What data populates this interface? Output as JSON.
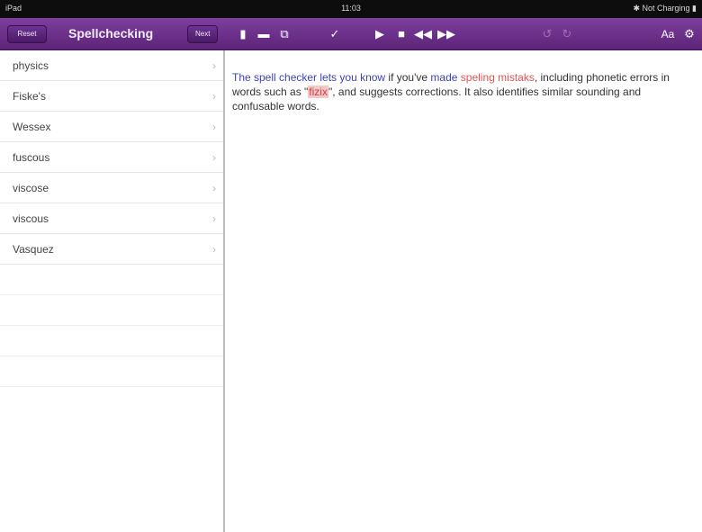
{
  "statusbar": {
    "device": "iPad",
    "time": "11:03",
    "battery": "Not Charging"
  },
  "toolbar": {
    "reset_label": "Reset",
    "title": "Spellchecking",
    "next_label": "Next",
    "font_label": "Aa",
    "colors": {
      "bar": "#6a2f8a",
      "button": "#5a2278"
    }
  },
  "word_list": [
    {
      "label": "physics"
    },
    {
      "label": "Fiske's"
    },
    {
      "label": "Wessex"
    },
    {
      "label": "fuscous"
    },
    {
      "label": "viscose"
    },
    {
      "label": "viscous"
    },
    {
      "label": "Vasquez"
    }
  ],
  "content": {
    "text_parts": [
      {
        "text": "The spell checker lets ",
        "style": "blue"
      },
      {
        "text": "you know",
        "style": "blue"
      },
      {
        "text": " if you've ",
        "style": "plain"
      },
      {
        "text": "made",
        "style": "blue"
      },
      {
        "text": " ",
        "style": "plain"
      },
      {
        "text": "speling mistaks",
        "style": "red"
      },
      {
        "text": ", including phonetic errors in words such as \"",
        "style": "plain"
      },
      {
        "text": "fizix",
        "style": "hl"
      },
      {
        "text": "\", and suggests corrections. It also identifies similar sounding and confusable words.",
        "style": "plain"
      }
    ]
  }
}
